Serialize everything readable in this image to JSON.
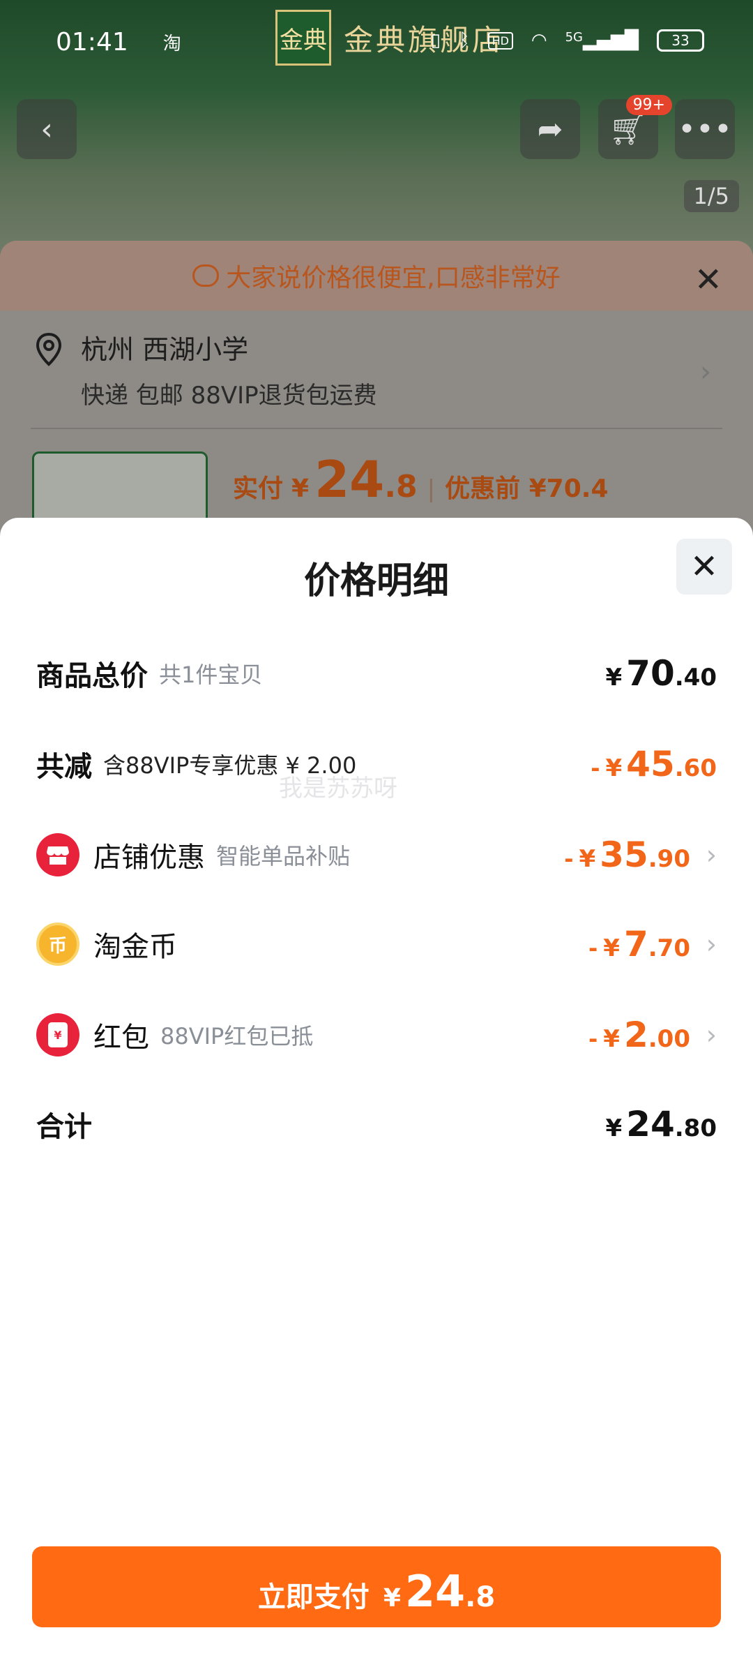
{
  "status_bar": {
    "time": "01:41",
    "app_icon": "淘",
    "battery": "33",
    "network": "5G",
    "hd": "HD"
  },
  "brand": {
    "logo_text": "金典",
    "name": "金典旗舰店"
  },
  "background": {
    "cart_badge": "99+",
    "image_counter": "1/5",
    "banner_text": "大家说价格很便宜,口感非常好",
    "address": {
      "line1": "杭州 西湖小学",
      "line2": "快递 包邮 88VIP退货包运费"
    },
    "price": {
      "label": "实付",
      "yen": "¥",
      "int": "24",
      "dec": ".8",
      "orig": "优惠前 ¥70.4"
    }
  },
  "sheet": {
    "title": "价格明细",
    "rows": [
      {
        "label": "商品总价",
        "sub": "共1件宝贝",
        "minus": "",
        "yen": "¥",
        "int": "70",
        "dec": ".40"
      },
      {
        "label": "共减",
        "sub": "含88VIP专享优惠 ¥ 2.00",
        "minus": "-",
        "yen": "¥",
        "int": "45",
        "dec": ".60"
      },
      {
        "label": "店铺优惠",
        "sub": "智能单品补贴",
        "minus": "-",
        "yen": "¥",
        "int": "35",
        "dec": ".90"
      },
      {
        "label": "淘金币",
        "sub": "",
        "minus": "-",
        "yen": "¥",
        "int": "7",
        "dec": ".70"
      },
      {
        "label": "红包",
        "sub": "88VIP红包已抵",
        "minus": "-",
        "yen": "¥",
        "int": "2",
        "dec": ".00"
      },
      {
        "label": "合计",
        "sub": "",
        "minus": "",
        "yen": "¥",
        "int": "24",
        "dec": ".80"
      }
    ],
    "coin_glyph": "币",
    "hongbao_glyph": "¥",
    "watermark": "我是苏苏呀"
  },
  "pay_button": {
    "label": "立即支付",
    "yen": "¥",
    "int": "24",
    "dec": ".8"
  },
  "colors": {
    "accent": "#ff6a12",
    "discount": "#f2661a",
    "store_red": "#e8223a",
    "coin": "#f7b52d"
  },
  "icons": [
    "back-icon",
    "share-icon",
    "cart-icon",
    "more-icon",
    "chat-icon",
    "location-pin-icon",
    "close-icon",
    "store-icon",
    "coin-icon",
    "hongbao-icon",
    "chevron-right-icon"
  ]
}
